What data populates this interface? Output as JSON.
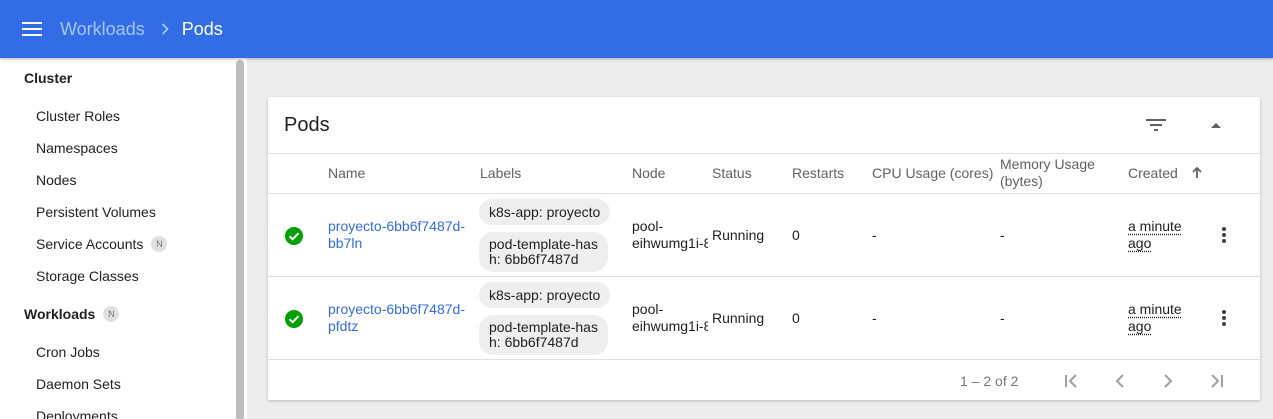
{
  "header": {
    "breadcrumb_parent": "Workloads",
    "breadcrumb_current": "Pods",
    "color": "#326de6"
  },
  "sidebar": {
    "cluster_title": "Cluster",
    "cluster_items": [
      {
        "label": "Cluster Roles"
      },
      {
        "label": "Namespaces"
      },
      {
        "label": "Nodes"
      },
      {
        "label": "Persistent Volumes"
      },
      {
        "label": "Service Accounts",
        "badge": "N"
      },
      {
        "label": "Storage Classes"
      }
    ],
    "workloads_title": "Workloads",
    "workloads_badge": "N",
    "workloads_items": [
      {
        "label": "Cron Jobs"
      },
      {
        "label": "Daemon Sets"
      },
      {
        "label": "Deployments"
      }
    ]
  },
  "card": {
    "title": "Pods",
    "icons": {
      "filter": "filter-icon",
      "collapse": "expand-less-icon"
    }
  },
  "table": {
    "headers": {
      "name": "Name",
      "labels": "Labels",
      "node": "Node",
      "status": "Status",
      "restarts": "Restarts",
      "cpu": "CPU Usage (cores)",
      "memory_line1": "Memory Usage",
      "memory_line2": "(bytes)",
      "created": "Created"
    },
    "rows": [
      {
        "name_line1": "proyecto-6bb6f7487d-",
        "name_line2": "bb7ln",
        "label1": "k8s-app: proyecto",
        "label2_line1": "pod-template-has",
        "label2_line2": "h: 6bb6f7487d",
        "node_line1": "pool-",
        "node_line2": "eihwumg1i-8",
        "status": "Running",
        "restarts": "0",
        "cpu": "-",
        "memory": "-",
        "created_line1": "a minute",
        "created_line2": "ago"
      },
      {
        "name_line1": "proyecto-6bb6f7487d-",
        "name_line2": "pfdtz",
        "label1": "k8s-app: proyecto",
        "label2_line1": "pod-template-has",
        "label2_line2": "h: 6bb6f7487d",
        "node_line1": "pool-",
        "node_line2": "eihwumg1i-8",
        "status": "Running",
        "restarts": "0",
        "cpu": "-",
        "memory": "-",
        "created_line1": "a minute",
        "created_line2": "ago"
      }
    ],
    "status_color": "#00a000"
  },
  "pagination": {
    "range": "1 – 2 of 2"
  }
}
